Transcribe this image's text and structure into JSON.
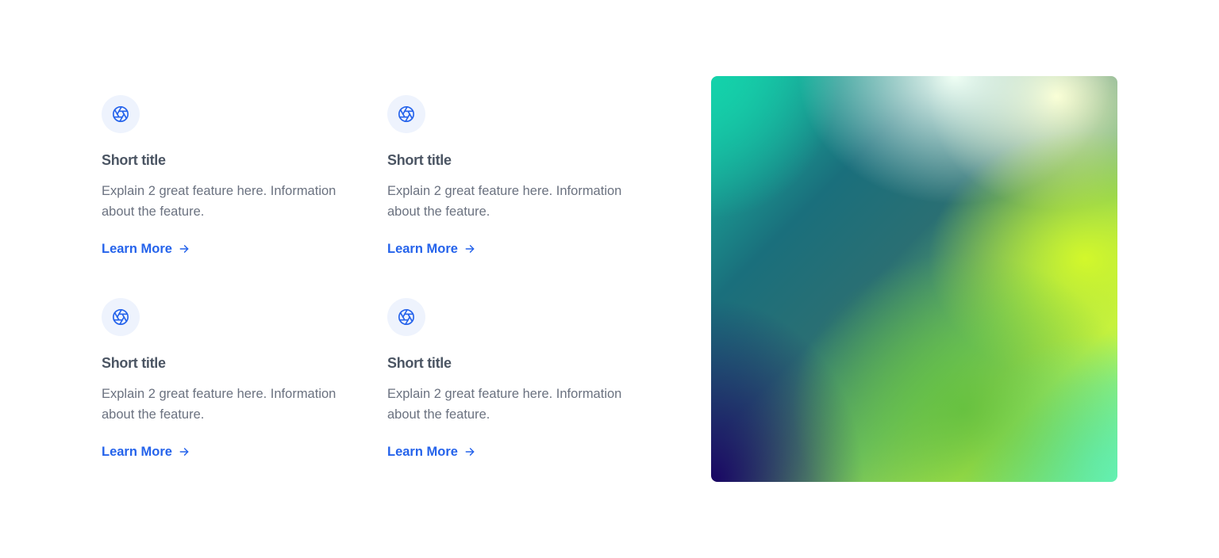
{
  "features": [
    {
      "title": "Short title",
      "description": "Explain 2 great feature here. Information about the feature.",
      "link_label": "Learn More",
      "icon": "aperture-icon"
    },
    {
      "title": "Short title",
      "description": "Explain 2 great feature here. Information about the feature.",
      "link_label": "Learn More",
      "icon": "aperture-icon"
    },
    {
      "title": "Short title",
      "description": "Explain 2 great feature here. Information about the feature.",
      "link_label": "Learn More",
      "icon": "aperture-icon"
    },
    {
      "title": "Short title",
      "description": "Explain 2 great feature here. Information about the feature.",
      "link_label": "Learn More",
      "icon": "aperture-icon"
    }
  ],
  "colors": {
    "accent": "#2563eb",
    "title": "#4b5563",
    "body": "#6b7280",
    "icon_bg": "#eef3fd"
  },
  "image": {
    "kind": "gradient-image"
  }
}
